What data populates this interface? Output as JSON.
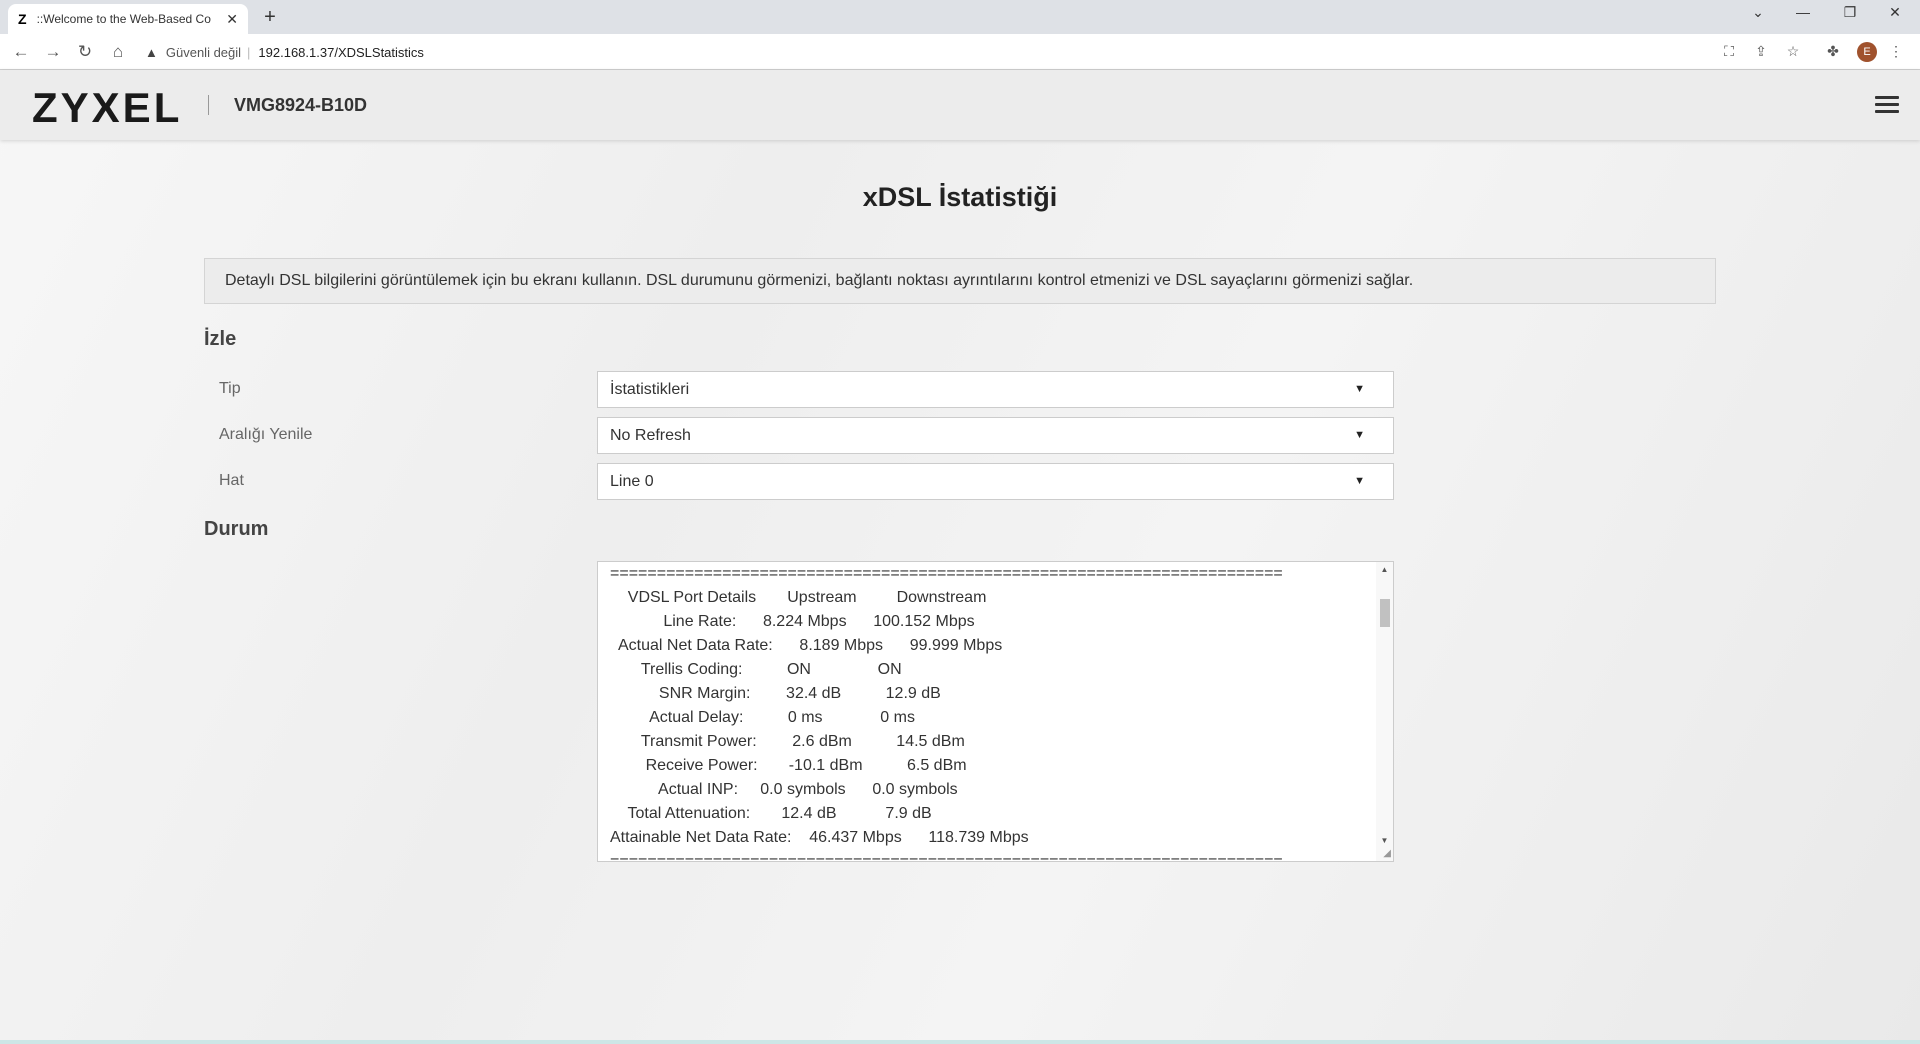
{
  "browser": {
    "tab_favicon": "Z",
    "tab_title": "::Welcome to the Web-Based Co",
    "new_tab": "+",
    "insecure_label": "Güvenli değil",
    "url": "192.168.1.37/XDSLStatistics",
    "avatar_letter": "E"
  },
  "header": {
    "logo": "ZYXEL",
    "model": "VMG8924-B10D"
  },
  "page": {
    "title": "xDSL İstatistiği",
    "description": "Detaylı DSL bilgilerini görüntülemek için bu ekranı kullanın. DSL durumunu görmenizi, bağlantı noktası ayrıntılarını kontrol etmenizi ve DSL sayaçlarını görmenizi sağlar."
  },
  "monitor": {
    "section_title": "İzle",
    "type_label": "Tip",
    "type_value": "İstatistikleri",
    "refresh_label": "Aralığı Yenile",
    "refresh_value": "No Refresh",
    "line_label": "Hat",
    "line_value": "Line 0"
  },
  "status": {
    "section_title": "Durum",
    "text": "========================================================================\n    VDSL Port Details       Upstream         Downstream\n            Line Rate:      8.224 Mbps      100.152 Mbps\n  Actual Net Data Rate:      8.189 Mbps      99.999 Mbps\n       Trellis Coding:          ON               ON\n           SNR Margin:        32.4 dB          12.9 dB\n         Actual Delay:          0 ms             0 ms\n       Transmit Power:        2.6 dBm          14.5 dBm\n        Receive Power:       -10.1 dBm          6.5 dBm\n           Actual INP:     0.0 symbols      0.0 symbols\n    Total Attenuation:       12.4 dB           7.9 dB\nAttainable Net Data Rate:    46.437 Mbps      118.739 Mbps\n========================================================================"
  }
}
